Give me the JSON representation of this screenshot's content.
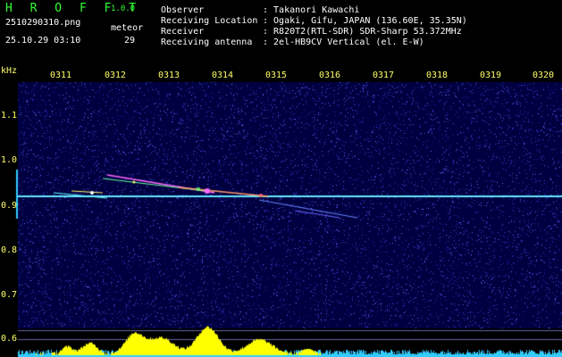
{
  "header": {
    "brand": "H R O F F T",
    "version": "1.0.0",
    "filename": "2510290310.png",
    "datetime": "25.10.29 03:10",
    "meteor_label": "meteor",
    "meteor_count": "29",
    "fields": [
      {
        "label": "Observer",
        "value": ": Takanori Kawachi"
      },
      {
        "label": "Receiving Location",
        "value": ": Ogaki, Gifu, JAPAN (136.60E, 35.35N)"
      },
      {
        "label": "Receiver",
        "value": ": R820T2(RTL-SDR) SDR-Sharp 53.372MHz"
      },
      {
        "label": "Receiving antenna",
        "value": ": 2el-HB9CV Vertical (el. E-W)"
      }
    ]
  },
  "spectrogram": {
    "y_unit": "kHz",
    "x_ticks": [
      "0311",
      "0312",
      "0313",
      "0314",
      "0315",
      "0316",
      "0317",
      "0318",
      "0319",
      "0320"
    ],
    "y_ticks": [
      "1.1",
      "1.0",
      "0.9",
      "0.8",
      "0.7",
      "0.6"
    ],
    "colors": {
      "background": "#000040",
      "carrier": "#66e6ff",
      "histogram": "#ffff00",
      "baseline": "#33ccff",
      "axis_text": "#ffff66"
    }
  }
}
